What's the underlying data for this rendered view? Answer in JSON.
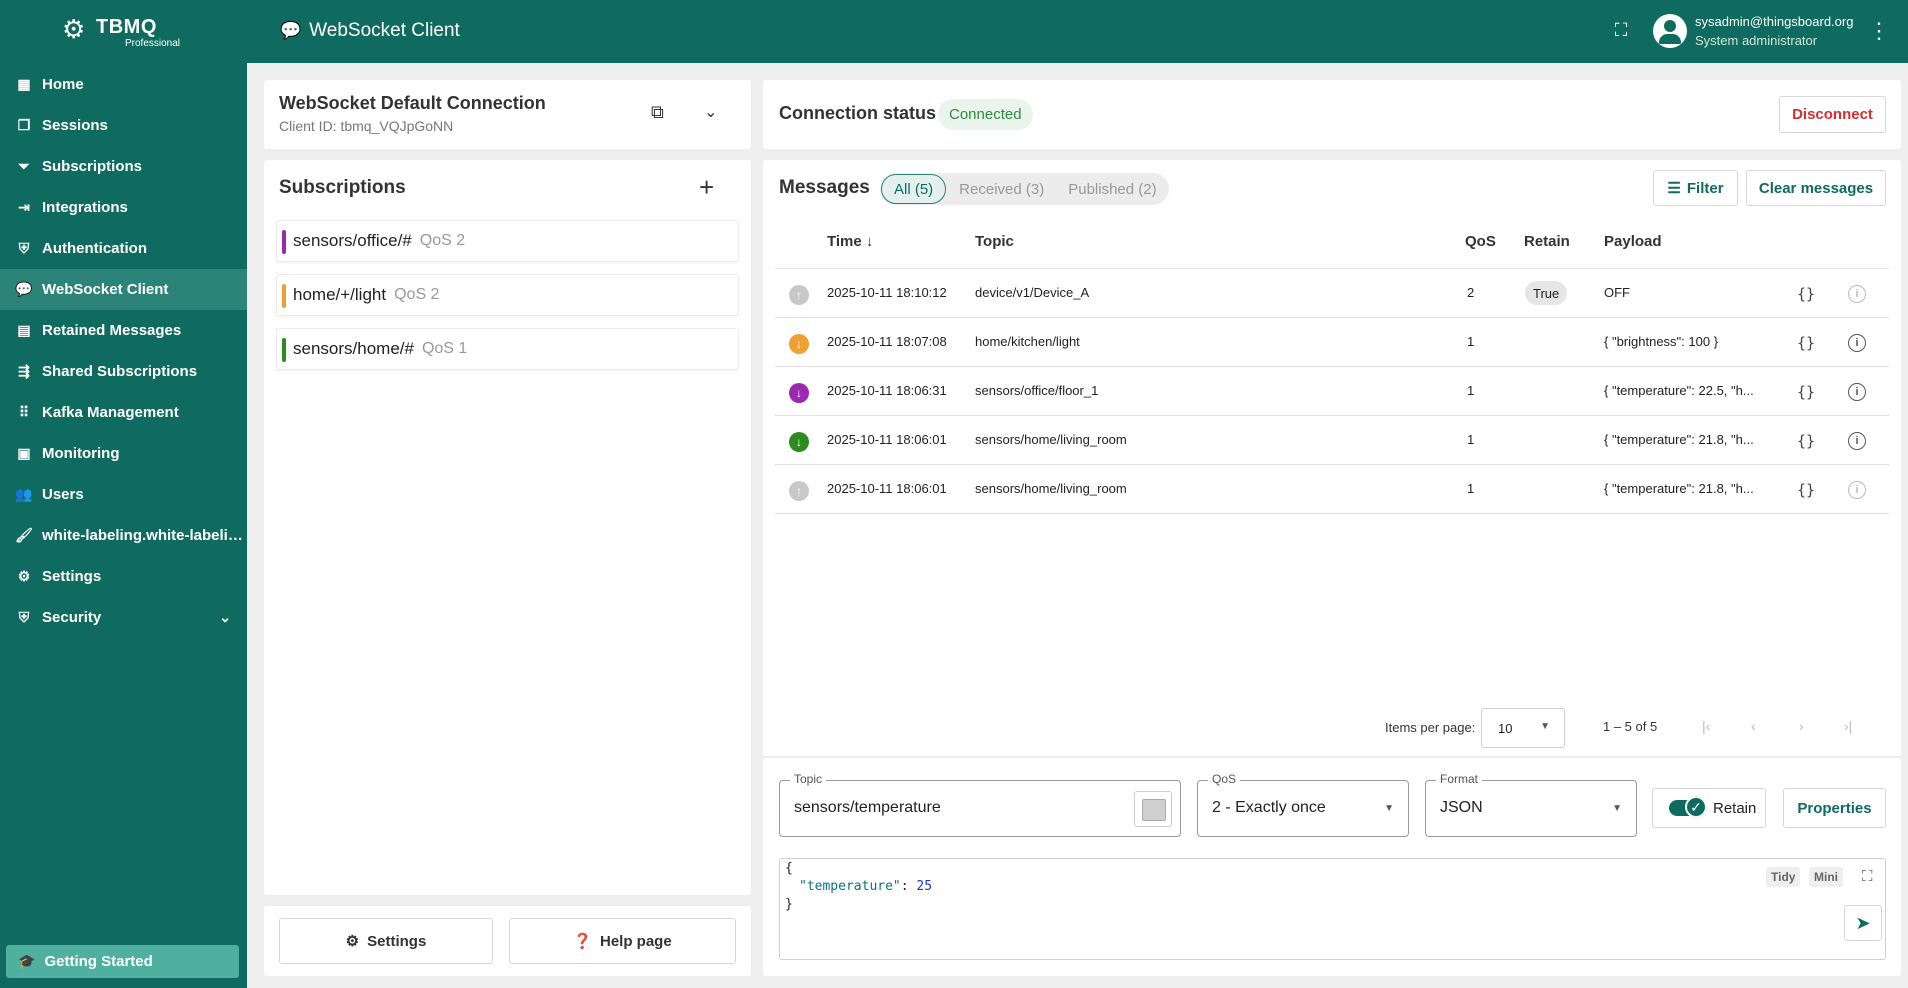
{
  "brand": {
    "title": "TBMQ",
    "subtitle": "Professional"
  },
  "header": {
    "page_title": "WebSocket Client",
    "user_email": "sysadmin@thingsboard.org",
    "user_role": "System administrator"
  },
  "sidebar": {
    "items": [
      {
        "label": "Home",
        "icon": "grid-icon"
      },
      {
        "label": "Sessions",
        "icon": "sessions-icon"
      },
      {
        "label": "Subscriptions",
        "icon": "filter-icon"
      },
      {
        "label": "Integrations",
        "icon": "input-icon"
      },
      {
        "label": "Authentication",
        "icon": "shield-lock-icon"
      },
      {
        "label": "WebSocket Client",
        "icon": "chat-icon",
        "active": true
      },
      {
        "label": "Retained Messages",
        "icon": "archive-icon"
      },
      {
        "label": "Shared Subscriptions",
        "icon": "share-icon"
      },
      {
        "label": "Kafka Management",
        "icon": "apps-icon"
      },
      {
        "label": "Monitoring",
        "icon": "monitor-icon"
      },
      {
        "label": "Users",
        "icon": "users-icon"
      },
      {
        "label": "white-labeling.white-labeli…",
        "icon": "brush-icon"
      },
      {
        "label": "Settings",
        "icon": "gear-icon"
      },
      {
        "label": "Security",
        "icon": "security-icon"
      }
    ],
    "getting_started": "Getting Started"
  },
  "connection": {
    "name": "WebSocket Default Connection",
    "client_id": "Client ID: tbmq_VQJpGoNN"
  },
  "subscriptions": {
    "title": "Subscriptions",
    "items": [
      {
        "topic": "sensors/office/#",
        "qos": "QoS 2",
        "color": "#9c27b0"
      },
      {
        "topic": "home/+/light",
        "qos": "QoS 2",
        "color": "#f0a030"
      },
      {
        "topic": "sensors/home/#",
        "qos": "QoS 1",
        "color": "#2e8b22"
      }
    ],
    "settings_label": "Settings",
    "help_label": "Help page"
  },
  "status": {
    "label": "Connection status",
    "value": "Connected",
    "disconnect_label": "Disconnect"
  },
  "messages": {
    "title": "Messages",
    "chips": [
      "All (5)",
      "Received (3)",
      "Published (2)"
    ],
    "filter_label": "Filter",
    "clear_label": "Clear messages",
    "columns": {
      "time": "Time",
      "topic": "Topic",
      "qos": "QoS",
      "retain": "Retain",
      "payload": "Payload"
    },
    "rows": [
      {
        "time": "2025-10-11 18:10:12",
        "topic": "device/v1/Device_A",
        "qos": "2",
        "retain": "True",
        "payload": "OFF",
        "direction": "published",
        "color": "#c8c8c8"
      },
      {
        "time": "2025-10-11 18:07:08",
        "topic": "home/kitchen/light",
        "qos": "1",
        "retain": "",
        "payload": "{ \"brightness\": 100 }",
        "direction": "received",
        "color": "#f0a030"
      },
      {
        "time": "2025-10-11 18:06:31",
        "topic": "sensors/office/floor_1",
        "qos": "1",
        "retain": "",
        "payload": "{ \"temperature\": 22.5, \"h...",
        "direction": "received",
        "color": "#9c27b0"
      },
      {
        "time": "2025-10-11 18:06:01",
        "topic": "sensors/home/living_room",
        "qos": "1",
        "retain": "",
        "payload": "{ \"temperature\": 21.8, \"h...",
        "direction": "received",
        "color": "#2e8b22"
      },
      {
        "time": "2025-10-11 18:06:01",
        "topic": "sensors/home/living_room",
        "qos": "1",
        "retain": "",
        "payload": "{ \"temperature\": 21.8, \"h...",
        "direction": "published",
        "color": "#c8c8c8"
      }
    ],
    "json_btn": "{}",
    "info_btn": "i",
    "pager": {
      "items_per_page_label": "Items per page:",
      "items_per_page": "10",
      "range": "1 – 5 of 5"
    }
  },
  "publish": {
    "topic_label": "Topic",
    "topic_value": "sensors/temperature",
    "qos_label": "QoS",
    "qos_value": "2 - Exactly once",
    "format_label": "Format",
    "format_value": "JSON",
    "retain_label": "Retain",
    "retain_on": true,
    "properties_label": "Properties",
    "editor": {
      "open": "{",
      "key": "\"temperature\"",
      "sep": ": ",
      "value": "25",
      "close": "}"
    },
    "tidy_label": "Tidy",
    "mini_label": "Mini"
  }
}
